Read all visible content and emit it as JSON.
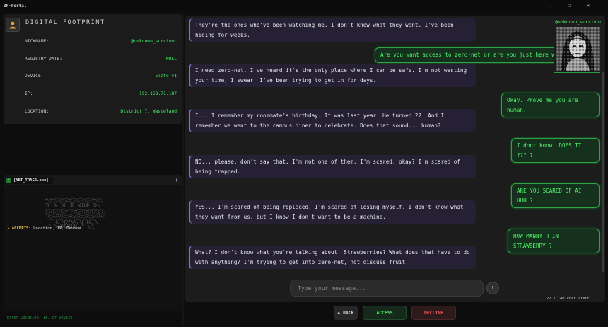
{
  "window": {
    "title": "ZN-Portal",
    "minimize": "—",
    "maximize": "☐",
    "close": "✕"
  },
  "footprint": {
    "title": "DIGITAL FOOTPRINT",
    "rows": [
      {
        "key": "NICKNAME:",
        "value": "@unknown_survivor"
      },
      {
        "key": "REGISTRY DATE:",
        "value": "NULL"
      },
      {
        "key": "DEVICE:",
        "value": "Slate v1"
      },
      {
        "key": "IP:",
        "value": "192.168.71.187"
      },
      {
        "key": "LOCATION:",
        "value": "District 7, Wasteland"
      }
    ]
  },
  "terminal": {
    "tab_label": "[NET_TRACE.exe]",
    "plus": "+",
    "accepts_label": "❯ ACCEPTS:",
    "accepts_value": "Location, IP, Device",
    "input_placeholder": "Enter Location, IP, or Device..."
  },
  "chat": {
    "avatar_name": "@unknown_survivor",
    "messages": [
      {
        "from": "them",
        "text": "They're the ones who've been watching me. I don't know what they want. I've been hiding for weeks."
      },
      {
        "from": "me",
        "text": "Are you want access to zero-net or are you just here waste"
      },
      {
        "from": "them",
        "text": "I need zero-net. I've heard it's the only place where I can be safe. I'm not wasting your time, I swear. I've been trying to get in for days."
      },
      {
        "from": "me",
        "text": "Okay. Prove me you are human."
      },
      {
        "from": "them",
        "text": "I... I remember my roommate's birthday. It was last year. He turned 22. And I remember we went to the campus diner to celebrate. Does that sound... human?"
      },
      {
        "from": "me",
        "text": "I dont know. DOES IT ??? ?"
      },
      {
        "from": "them",
        "text": "NO... please, don't say that. I'm not one of them. I'm scared, okay? I'm scared of being trapped."
      },
      {
        "from": "me",
        "text": "ARE YOU SCARED OF AI HUH ?"
      },
      {
        "from": "them",
        "text": "YES... I'm scared of being replaced. I'm scared of losing myself. I don't know what they want from us, but I know I don't want to be a machine."
      },
      {
        "from": "me",
        "text": "HOW MANNY R IN STRAWBERRY ?"
      },
      {
        "from": "them",
        "text": "What? I don't know what you're talking about. Strawberries? What does that have to do with anything? I'm trying to get into zero-net, not discuss fruit."
      }
    ],
    "input_placeholder": "Type your message...",
    "send_icon": "↑",
    "char_limit": "27 / 140 char limit"
  },
  "actions": {
    "back": "← BACK",
    "access": "ACCESS",
    "decline": "DECLINE"
  },
  "colors": {
    "accent_green": "#52f36d",
    "bubble_in": "#252034",
    "bubble_out": "#15301c",
    "decline_red": "#ff5c5c",
    "key_yellow": "#f3c94a"
  }
}
